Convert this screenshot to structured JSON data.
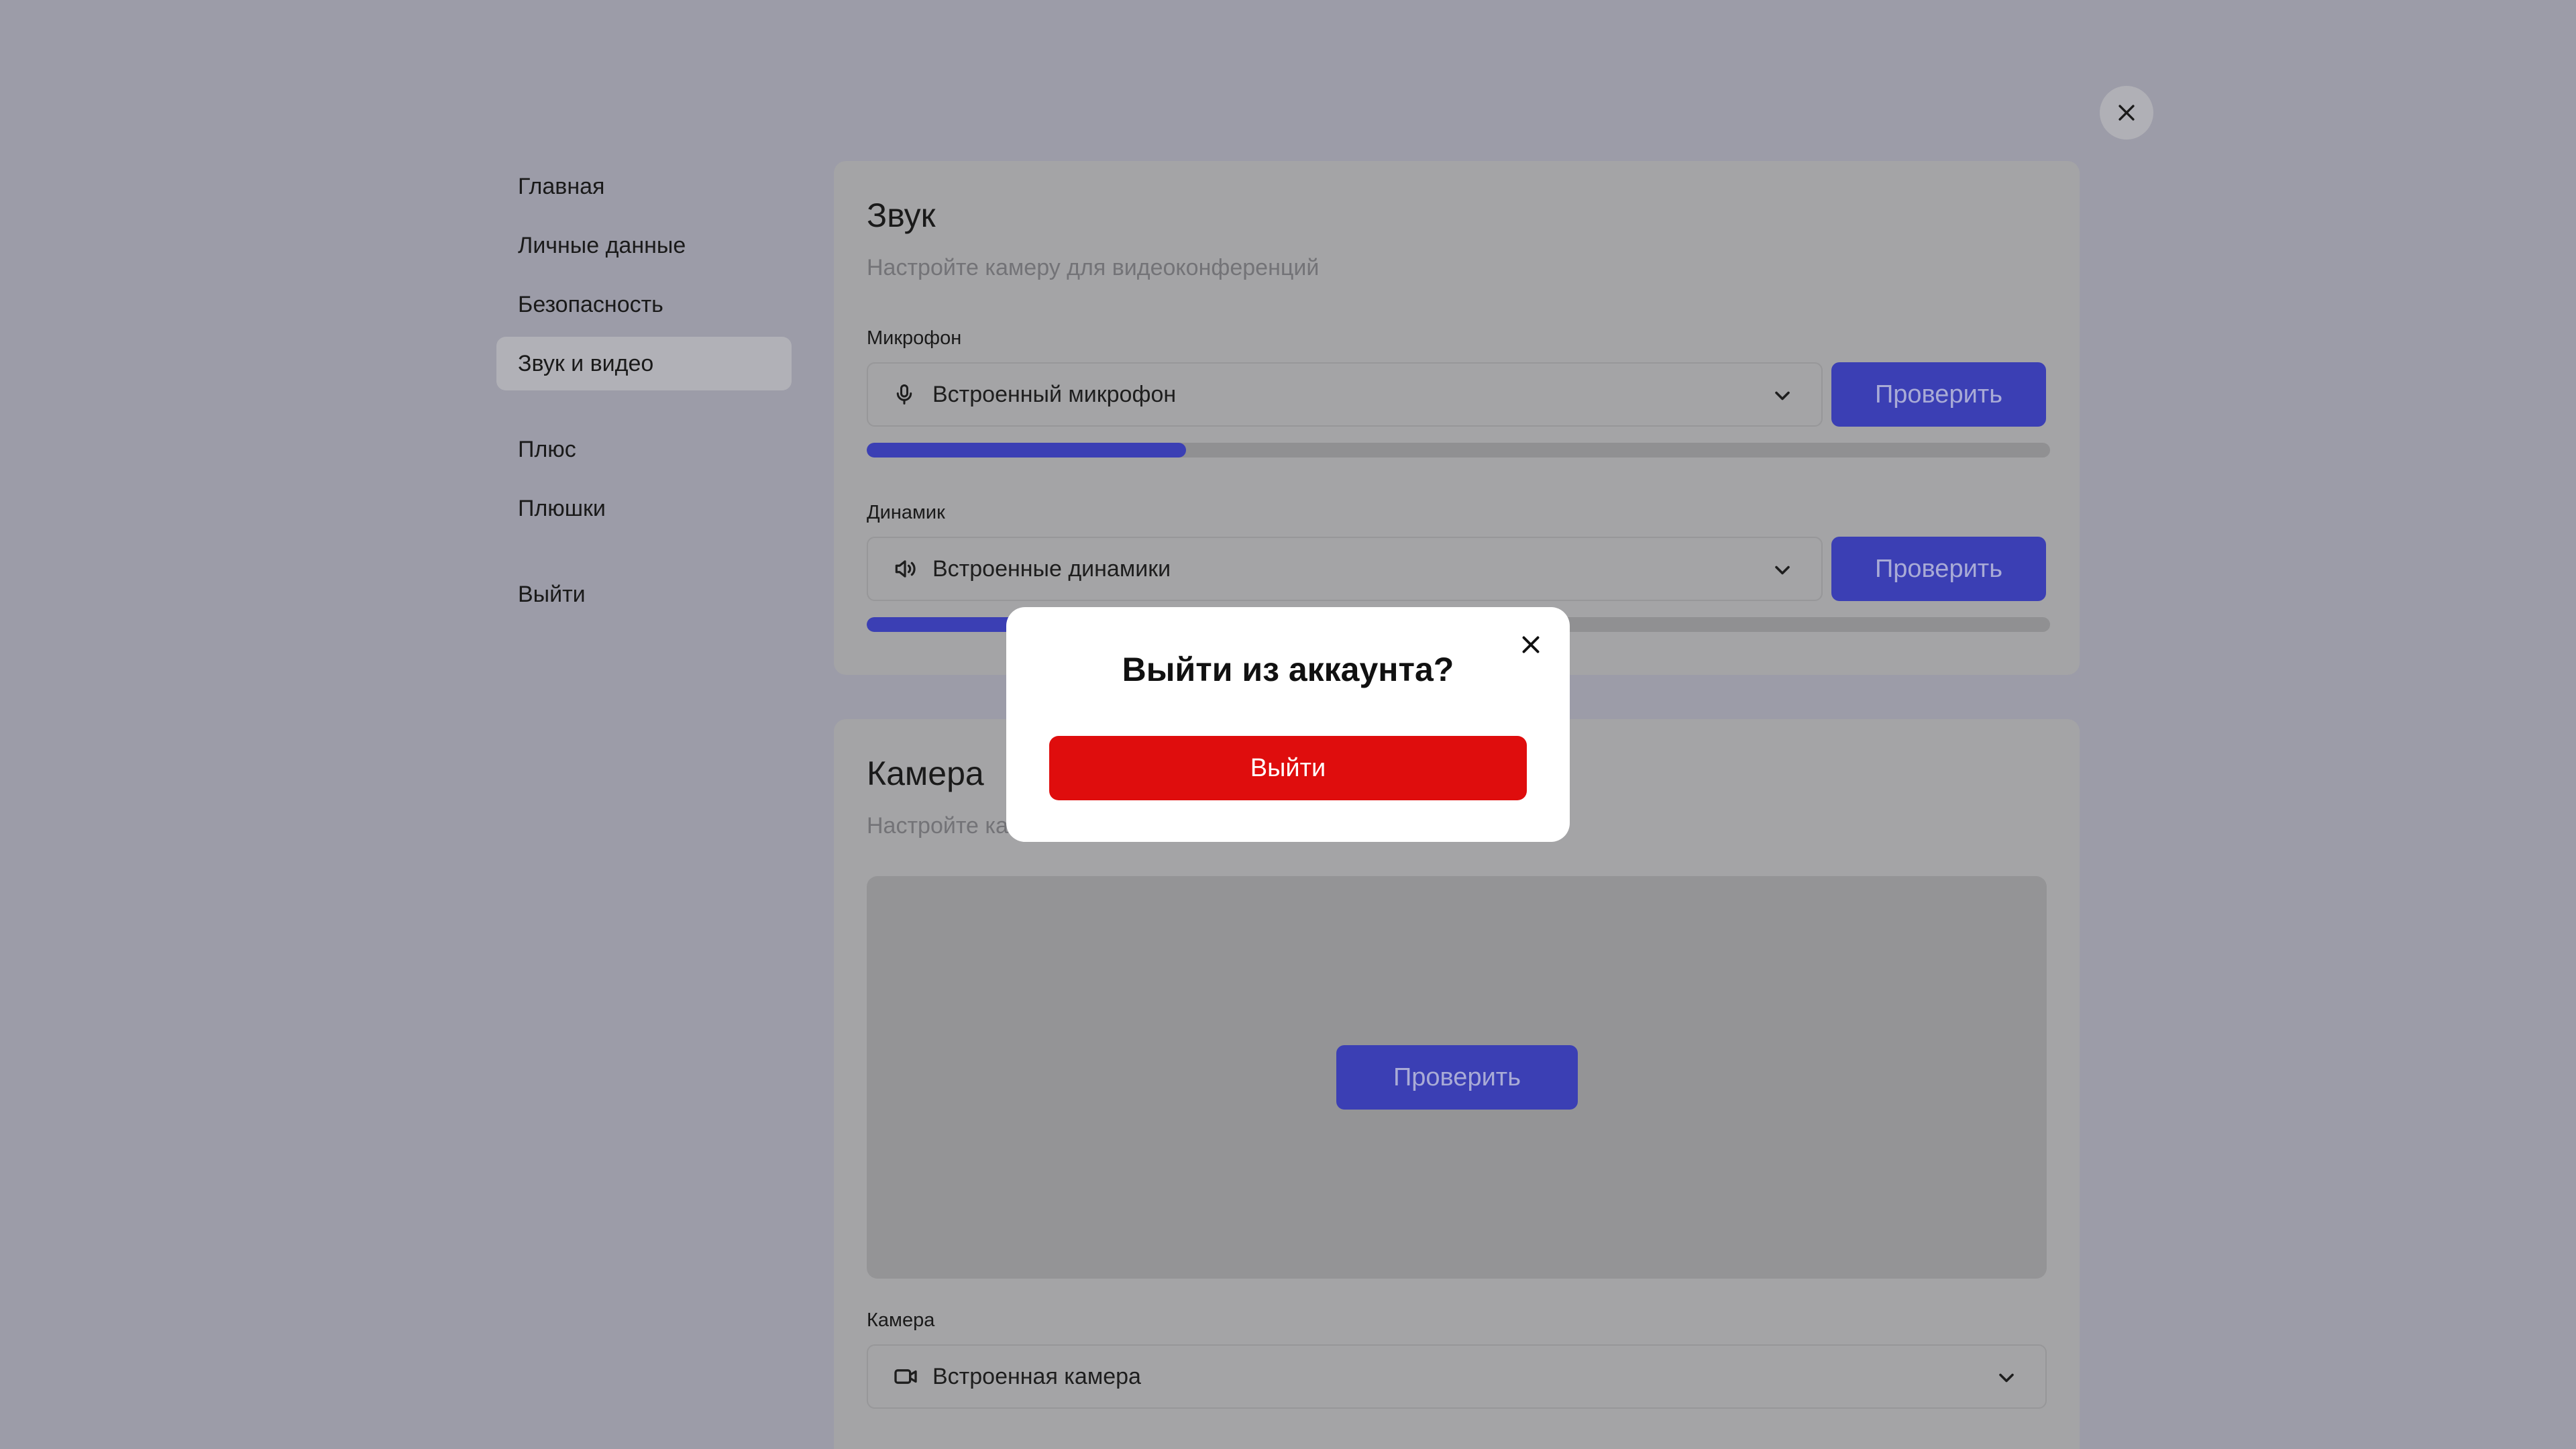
{
  "nav": {
    "items": [
      {
        "label": "Главная"
      },
      {
        "label": "Личные данные"
      },
      {
        "label": "Безопасность"
      },
      {
        "label": "Звук и видео",
        "active": true
      },
      {
        "label": "Плюс"
      },
      {
        "label": "Плюшки"
      },
      {
        "label": "Выйти"
      }
    ]
  },
  "sound": {
    "title": "Звук",
    "subtitle": "Настройте камеру для видеоконференций",
    "mic": {
      "label": "Микрофон",
      "value": "Встроенный микрофон",
      "icon": "microphone-icon",
      "button": "Проверить",
      "level": 0.27
    },
    "speaker": {
      "label": "Динамик",
      "value": "Встроенные динамики",
      "icon": "speaker-icon",
      "button": "Проверить",
      "level": 0.27
    }
  },
  "camera": {
    "title": "Камера",
    "subtitle": "Настройте камеру для видеоконференций",
    "preview_button": "Проверить",
    "label": "Камера",
    "value": "Встроенная камера",
    "icon": "camera-icon"
  },
  "modal": {
    "title": "Выйти из аккаунта?",
    "confirm": "Выйти"
  },
  "colors": {
    "accent": "#3b3fb4",
    "danger": "#df0d0d",
    "overlay": "#9c9ca8"
  }
}
